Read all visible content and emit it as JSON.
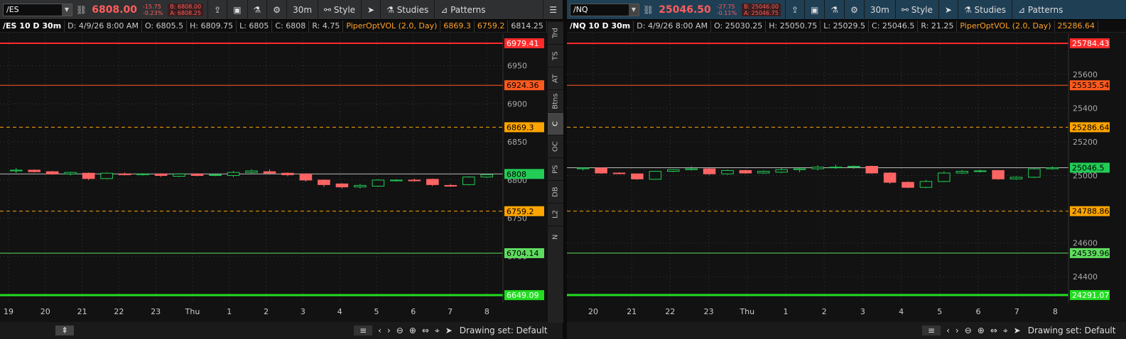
{
  "left": {
    "symbol": "/ES",
    "price": "6808.00",
    "change": "-15.75",
    "change_pct": "-0.23%",
    "bid": "B: 6808.00",
    "ask": "A: 6808.25",
    "timeframe": "30m",
    "style_label": "Style",
    "studies_label": "Studies",
    "patterns_label": "Patterns",
    "info": {
      "title": "/ES 10 D 30m",
      "date": "D: 4/9/26 8:00 AM",
      "open": "O: 6805.5",
      "high": "H: 6809.75",
      "low": "L: 6805",
      "close": "C: 6808",
      "range": "R: 4.75",
      "study": "PiperOptVOL (2.0, Day)",
      "v1": "6869.3",
      "v2": "6759.2",
      "v3": "6814.25"
    },
    "levels": [
      {
        "label": "6979.41",
        "value": 6979.41,
        "color": "#ff2a2a",
        "style": "solid",
        "width": 2
      },
      {
        "label": "6924.36",
        "value": 6924.36,
        "color": "#ff5a1f",
        "style": "solid",
        "width": 1
      },
      {
        "label": "6869.3",
        "value": 6869.3,
        "color": "#ffa500",
        "style": "dash",
        "width": 1
      },
      {
        "label": "6808",
        "value": 6808,
        "color": "#ffffff",
        "style": "solid",
        "width": 1,
        "current": true
      },
      {
        "label": "6759.2",
        "value": 6759.2,
        "color": "#ffa500",
        "style": "dash",
        "width": 1
      },
      {
        "label": "6704.14",
        "value": 6704.14,
        "color": "#5fdc5f",
        "style": "solid",
        "width": 1
      },
      {
        "label": "6649.09",
        "value": 6649.09,
        "color": "#22dd22",
        "style": "solid",
        "width": 3
      }
    ],
    "y_ticks": [
      "6950",
      "6900",
      "6850",
      "6800",
      "6750",
      "6700"
    ],
    "y_tick_values": [
      6950,
      6900,
      6850,
      6800,
      6750,
      6700
    ],
    "y_range": [
      6639,
      6985
    ],
    "x_ticks": [
      "19",
      "20",
      "21",
      "22",
      "23",
      "Thu",
      "1",
      "2",
      "3",
      "4",
      "5",
      "6",
      "7",
      "8"
    ],
    "candles": [
      [
        6812,
        6816,
        6809,
        6813
      ],
      [
        6813,
        6814,
        6810,
        6811
      ],
      [
        6811,
        6812,
        6807,
        6808
      ],
      [
        6808,
        6811,
        6806,
        6810
      ],
      [
        6809,
        6810,
        6800,
        6802
      ],
      [
        6802,
        6810,
        6801,
        6809
      ],
      [
        6808,
        6810,
        6806,
        6807
      ],
      [
        6807,
        6809,
        6806,
        6808
      ],
      [
        6808,
        6809,
        6804,
        6806
      ],
      [
        6805,
        6809,
        6804,
        6808
      ],
      [
        6808,
        6809,
        6805,
        6806
      ],
      [
        6806,
        6808,
        6805,
        6807
      ],
      [
        6806,
        6812,
        6804,
        6810
      ],
      [
        6810,
        6814,
        6808,
        6812
      ],
      [
        6811,
        6814,
        6807,
        6809
      ],
      [
        6809,
        6810,
        6805,
        6807
      ],
      [
        6808,
        6809,
        6798,
        6800
      ],
      [
        6800,
        6801,
        6791,
        6794
      ],
      [
        6795,
        6796,
        6789,
        6791
      ],
      [
        6791,
        6795,
        6789,
        6793
      ],
      [
        6792,
        6801,
        6791,
        6800
      ],
      [
        6799,
        6801,
        6798,
        6800
      ],
      [
        6800,
        6802,
        6798,
        6799
      ],
      [
        6801,
        6802,
        6792,
        6794
      ],
      [
        6793,
        6795,
        6791,
        6792
      ],
      [
        6794,
        6805,
        6793,
        6804
      ],
      [
        6804,
        6808,
        6803,
        6807
      ]
    ]
  },
  "right": {
    "symbol": "/NQ",
    "price": "25046.50",
    "change": "-27.75",
    "change_pct": "-0.11%",
    "bid": "B: 25046.00",
    "ask": "A: 25046.75",
    "timeframe": "30m",
    "style_label": "Style",
    "studies_label": "Studies",
    "patterns_label": "Patterns",
    "info": {
      "title": "/NQ 10 D 30m",
      "date": "D: 4/9/26 8:00 AM",
      "open": "O: 25030.25",
      "high": "H: 25050.75",
      "low": "L: 25029.5",
      "close": "C: 25046.5",
      "range": "R: 21.25",
      "study": "PiperOptVOL (2.0, Day)",
      "v1": "25286.64"
    },
    "levels": [
      {
        "label": "25784.43",
        "value": 25784.43,
        "color": "#ff2a2a",
        "style": "solid",
        "width": 2
      },
      {
        "label": "25535.54",
        "value": 25535.54,
        "color": "#ff5a1f",
        "style": "solid",
        "width": 1
      },
      {
        "label": "25286.64",
        "value": 25286.64,
        "color": "#ffa500",
        "style": "dash",
        "width": 1
      },
      {
        "label": "25046.5",
        "value": 25046.5,
        "color": "#ffffff",
        "style": "solid",
        "width": 1,
        "current": true
      },
      {
        "label": "24788.86",
        "value": 24788.86,
        "color": "#ffa500",
        "style": "dash",
        "width": 1
      },
      {
        "label": "24539.96",
        "value": 24539.96,
        "color": "#5fdc5f",
        "style": "solid",
        "width": 1
      },
      {
        "label": "24291.07",
        "value": 24291.07,
        "color": "#22dd22",
        "style": "solid",
        "width": 3
      }
    ],
    "y_ticks": [
      "25600",
      "25400",
      "25200",
      "25000",
      "24800",
      "24600",
      "24400"
    ],
    "y_tick_values": [
      25600,
      25400,
      25200,
      25000,
      24800,
      24600,
      24400
    ],
    "y_range": [
      24245,
      25810
    ],
    "x_ticks": [
      "20",
      "21",
      "22",
      "23",
      "Thu",
      "1",
      "2",
      "3",
      "4",
      "5",
      "6",
      "7",
      "8"
    ],
    "candles": [
      [
        25040,
        25048,
        25030,
        25045
      ],
      [
        25045,
        25048,
        25010,
        25015
      ],
      [
        25015,
        25020,
        25008,
        25012
      ],
      [
        25010,
        25012,
        24975,
        24980
      ],
      [
        24978,
        25028,
        24975,
        25025
      ],
      [
        25025,
        25038,
        25020,
        25035
      ],
      [
        25035,
        25055,
        25030,
        25040
      ],
      [
        25040,
        25050,
        25005,
        25010
      ],
      [
        25010,
        25035,
        25005,
        25030
      ],
      [
        25030,
        25035,
        25010,
        25015
      ],
      [
        25015,
        25030,
        25010,
        25025
      ],
      [
        25020,
        25045,
        25015,
        25035
      ],
      [
        25035,
        25050,
        25020,
        25040
      ],
      [
        25040,
        25060,
        25030,
        25050
      ],
      [
        25050,
        25065,
        25040,
        25050
      ],
      [
        25050,
        25060,
        25040,
        25055
      ],
      [
        25055,
        25058,
        25010,
        25015
      ],
      [
        25015,
        25020,
        24950,
        24960
      ],
      [
        24960,
        24965,
        24925,
        24930
      ],
      [
        24930,
        24975,
        24925,
        24965
      ],
      [
        24965,
        25025,
        24960,
        25015
      ],
      [
        25015,
        25032,
        25010,
        25025
      ],
      [
        25025,
        25035,
        25018,
        25028
      ],
      [
        25030,
        25032,
        24975,
        24980
      ],
      [
        24980,
        24995,
        24975,
        24990
      ],
      [
        24990,
        25045,
        24985,
        25040
      ],
      [
        25040,
        25055,
        25035,
        25046
      ]
    ]
  },
  "side_tabs": [
    "Trd",
    "TS",
    "AT",
    "Btns",
    "C",
    "OC",
    "PS",
    "DB",
    "L2",
    "N"
  ],
  "side_tab_active": "C",
  "drawing_set": "Drawing set: Default",
  "colors": {
    "up": "#22cc55",
    "down": "#ff6464",
    "bg": "#121212"
  }
}
